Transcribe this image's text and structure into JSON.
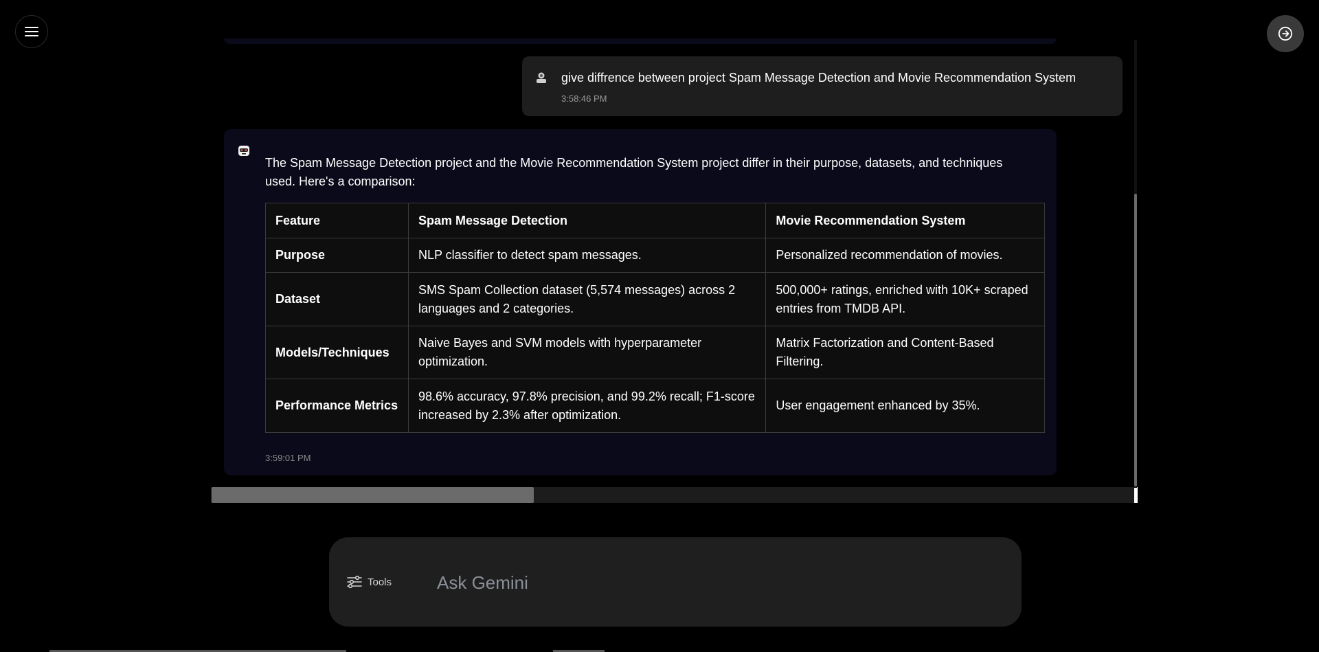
{
  "icons": {
    "menu": "hamburger-menu-icon",
    "exit": "arrow-right-circle-icon",
    "user": "user-avatar-icon",
    "bot": "bot-avatar-icon",
    "tools": "sliders-icon"
  },
  "user_message": {
    "text": "give diffrence between project Spam Message Detection and Movie Recommendation System",
    "time": "3:58:46 PM"
  },
  "bot_message": {
    "intro": "The Spam Message Detection project and the Movie Recommendation System project differ in their purpose, datasets, and techniques used. Here's a comparison:",
    "table": {
      "headers": [
        "Feature",
        "Spam Message Detection",
        "Movie Recommendation System"
      ],
      "rows": [
        [
          "Purpose",
          "NLP classifier to detect spam messages.",
          "Personalized recommendation of movies."
        ],
        [
          "Dataset",
          "SMS Spam Collection dataset (5,574 messages) across 2 languages and 2 categories.",
          "500,000+ ratings, enriched with 10K+ scraped entries from TMDB API."
        ],
        [
          "Models/Techniques",
          "Naive Bayes and SVM models with hyperparameter optimization.",
          "Matrix Factorization and Content-Based Filtering."
        ],
        [
          "Performance Metrics",
          "98.6% accuracy, 97.8% precision, and 99.2% recall; F1-score increased by 2.3% after optimization.",
          "User engagement enhanced by 35%."
        ]
      ]
    },
    "time": "3:59:01 PM"
  },
  "composer": {
    "tools_label": "Tools",
    "placeholder": "Ask Gemini"
  },
  "colors": {
    "background": "#000000",
    "user_bubble": "#1e1e1e",
    "bot_bubble": "#0a0a1a",
    "composer": "#1f1f1f"
  }
}
